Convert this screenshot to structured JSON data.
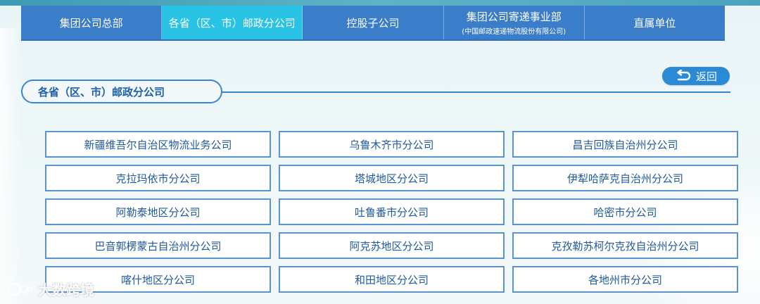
{
  "nav": {
    "tabs": [
      {
        "label": "集团公司总部",
        "sub": ""
      },
      {
        "label": "各省（区、市）邮政分公司",
        "sub": ""
      },
      {
        "label": "控股子公司",
        "sub": ""
      },
      {
        "label": "集团公司寄递事业部",
        "sub": "(中国邮政速递物流股份有限公司)"
      },
      {
        "label": "直属单位",
        "sub": ""
      }
    ],
    "active_index": 1
  },
  "back_button": {
    "label": "返回",
    "icon": "return-arrow-icon"
  },
  "section": {
    "title": "各省（区、市）邮政分公司"
  },
  "branches": [
    "新疆维吾尔自治区物流业务公司",
    "乌鲁木齐市分公司",
    "昌吉回族自治州分公司",
    "克拉玛依市分公司",
    "塔城地区分公司",
    "伊犁哈萨克自治州分公司",
    "阿勒泰地区分公司",
    "吐鲁番市分公司",
    "哈密市分公司",
    "巴音郭楞蒙古自治州分公司",
    "阿克苏地区分公司",
    "克孜勒苏柯尔克孜自治州分公司",
    "喀什地区分公司",
    "和田地区分公司",
    "各地州市分公司"
  ],
  "watermark": {
    "text": "大数跨境"
  },
  "colors": {
    "nav_bg": "#3a7dc9",
    "nav_active": "#29c3e6",
    "accent": "#3b85cc",
    "card_text": "#1e5a9e"
  }
}
